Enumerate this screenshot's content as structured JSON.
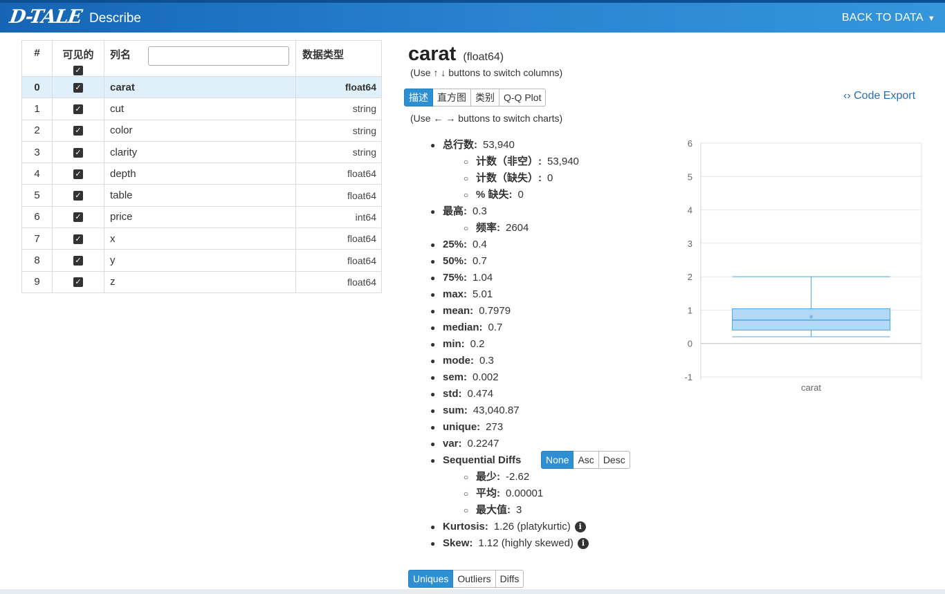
{
  "header": {
    "logo": "D-TALE",
    "page_title": "Describe",
    "back_label": "BACK TO DATA"
  },
  "columns_table": {
    "headers": {
      "index": "#",
      "visible": "可见的",
      "name": "列名",
      "dtype": "数据类型"
    },
    "rows": [
      {
        "index": "0",
        "name": "carat",
        "dtype": "float64",
        "selected": true
      },
      {
        "index": "1",
        "name": "cut",
        "dtype": "string"
      },
      {
        "index": "2",
        "name": "color",
        "dtype": "string"
      },
      {
        "index": "3",
        "name": "clarity",
        "dtype": "string"
      },
      {
        "index": "4",
        "name": "depth",
        "dtype": "float64"
      },
      {
        "index": "5",
        "name": "table",
        "dtype": "float64"
      },
      {
        "index": "6",
        "name": "price",
        "dtype": "int64"
      },
      {
        "index": "7",
        "name": "x",
        "dtype": "float64"
      },
      {
        "index": "8",
        "name": "y",
        "dtype": "float64"
      },
      {
        "index": "9",
        "name": "z",
        "dtype": "float64"
      }
    ]
  },
  "detail": {
    "column_name": "carat",
    "column_dtype": "(float64)",
    "hint_columns": "(Use ↑ ↓ buttons to switch columns)",
    "hint_charts": "(Use ← → buttons to switch charts)",
    "chart_tabs": [
      "描述",
      "直方图",
      "类别",
      "Q-Q Plot"
    ],
    "code_export": "Code Export",
    "bottom_tabs": [
      "Uniques",
      "Outliers",
      "Diffs"
    ]
  },
  "stats": {
    "total_label": "总行数:",
    "total": "53,940",
    "count_label": "计数（非空）:",
    "count": "53,940",
    "missing_label": "计数（缺失）:",
    "missing": "0",
    "pct_missing_label": "% 缺失:",
    "pct_missing": "0",
    "top_label": "最高:",
    "top": "0.3",
    "freq_label": "频率:",
    "freq": "2604",
    "p25_label": "25%:",
    "p25": "0.4",
    "p50_label": "50%:",
    "p50": "0.7",
    "p75_label": "75%:",
    "p75": "1.04",
    "max_label": "max:",
    "max": "5.01",
    "mean_label": "mean:",
    "mean": "0.7979",
    "median_label": "median:",
    "median": "0.7",
    "min_label": "min:",
    "min": "0.2",
    "mode_label": "mode:",
    "mode": "0.3",
    "sem_label": "sem:",
    "sem": "0.002",
    "std_label": "std:",
    "std": "0.474",
    "sum_label": "sum:",
    "sum": "43,040.87",
    "unique_label": "unique:",
    "unique": "273",
    "var_label": "var:",
    "var": "0.2247",
    "seq_label": "Sequential Diffs",
    "seq_buttons": [
      "None",
      "Asc",
      "Desc"
    ],
    "seq_min_label": "最少:",
    "seq_min": "-2.62",
    "seq_avg_label": "平均:",
    "seq_avg": "0.00001",
    "seq_max_label": "最大值:",
    "seq_max": "3",
    "kurtosis_label": "Kurtosis:",
    "kurtosis": "1.26 (platykurtic)",
    "skew_label": "Skew:",
    "skew": "1.12 (highly skewed)"
  },
  "colors": {
    "header": "#1f78c7",
    "accent": "#2f8fd3",
    "selected_row": "#dff0fb",
    "box_fill": "#a6d2f5",
    "box_stroke": "#4aa8ea"
  },
  "chart_data": {
    "type": "box",
    "categories": [
      "carat"
    ],
    "yticks": [
      "6",
      "5",
      "4",
      "3",
      "2",
      "1",
      "0",
      "-1"
    ],
    "ylim": [
      -1,
      6
    ],
    "box": {
      "q1": 0.4,
      "median": 0.7,
      "q3": 1.04,
      "whisker_low": 0.2,
      "whisker_high": 2.0,
      "mean": 0.7979
    },
    "grid": true
  }
}
